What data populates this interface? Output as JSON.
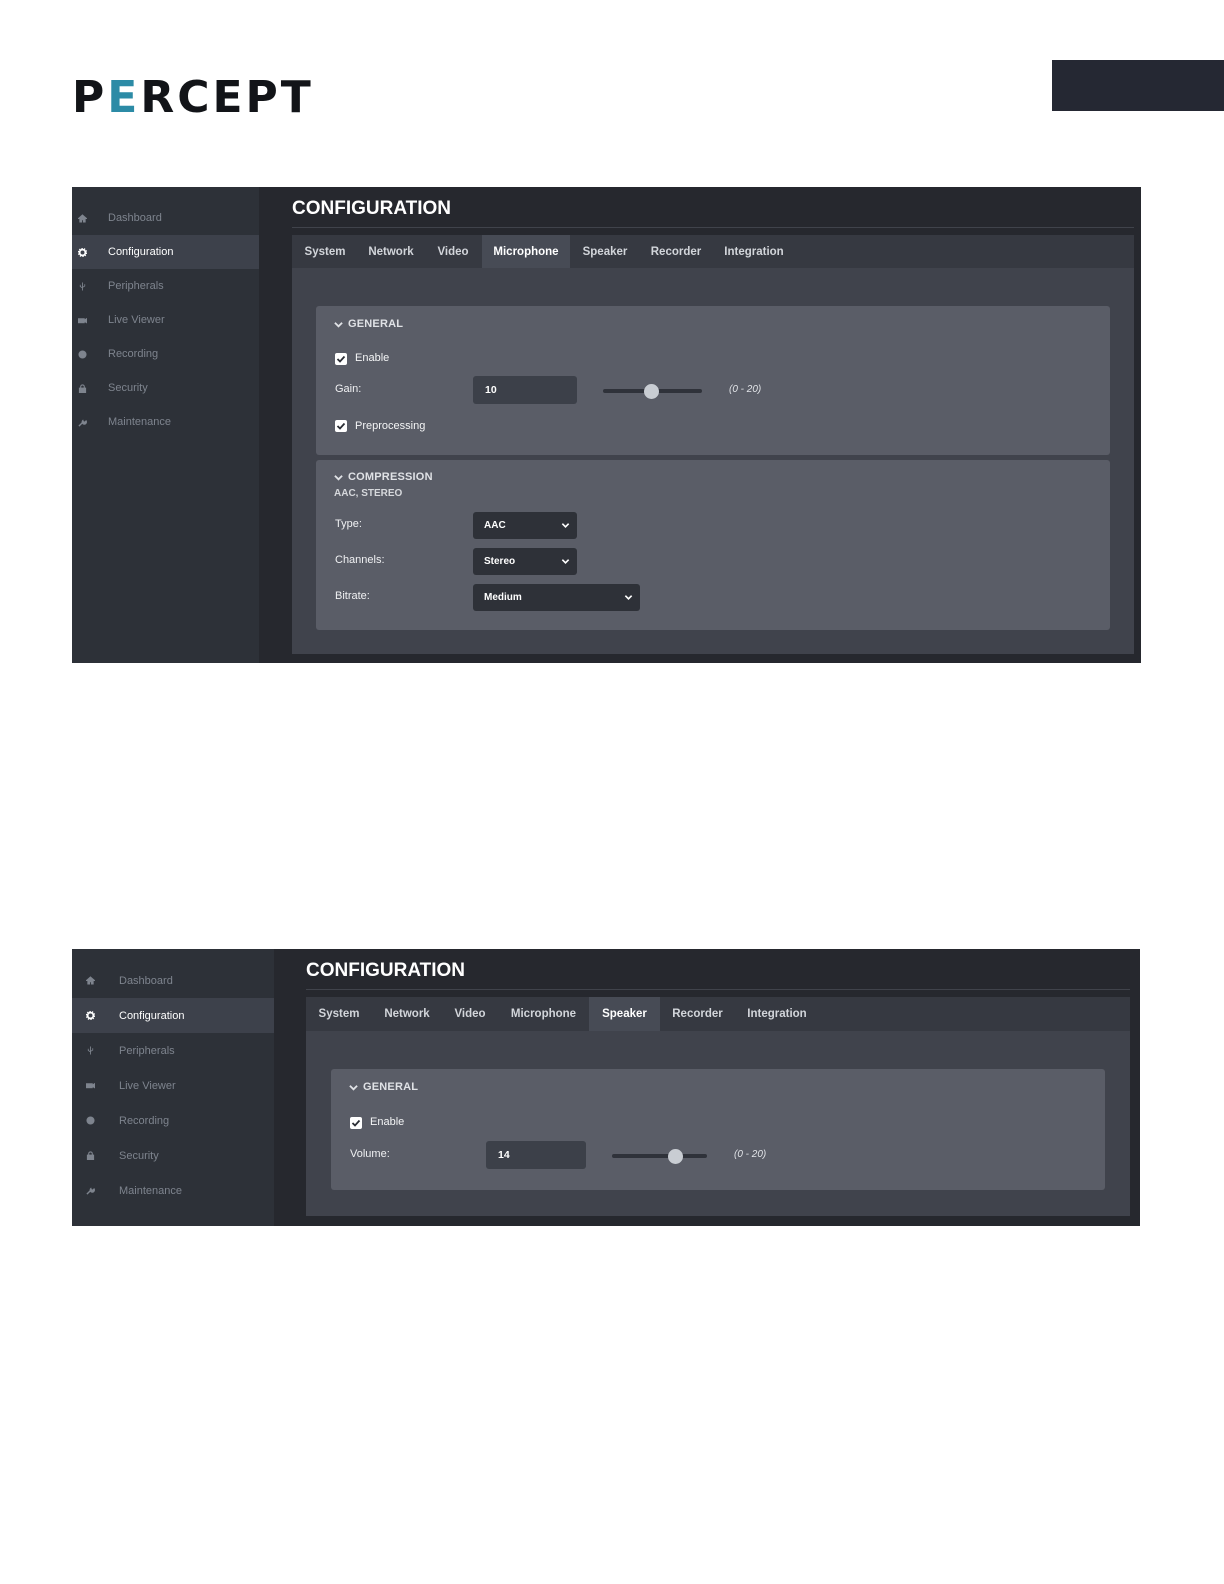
{
  "logo": {
    "text_a": "P",
    "text_accent": "E",
    "text_b": "RCEPT"
  },
  "nav_items": [
    {
      "label": "Dashboard",
      "icon": "home-icon"
    },
    {
      "label": "Configuration",
      "icon": "gear-icon"
    },
    {
      "label": "Peripherals",
      "icon": "usb-icon"
    },
    {
      "label": "Live Viewer",
      "icon": "camera-icon"
    },
    {
      "label": "Recording",
      "icon": "record-icon"
    },
    {
      "label": "Security",
      "icon": "lock-icon"
    },
    {
      "label": "Maintenance",
      "icon": "wrench-icon"
    }
  ],
  "tabs": [
    "System",
    "Network",
    "Video",
    "Microphone",
    "Speaker",
    "Recorder",
    "Integration"
  ],
  "microphone_screen": {
    "active_nav": "Configuration",
    "title": "CONFIGURATION",
    "active_tab": "Microphone",
    "general": {
      "heading": "GENERAL",
      "enable_label": "Enable",
      "enable_checked": true,
      "gain_label": "Gain:",
      "gain_value": "10",
      "gain_range": "(0 - 20)",
      "preprocessing_label": "Preprocessing",
      "preprocessing_checked": true
    },
    "compression": {
      "heading": "COMPRESSION",
      "summary": "AAC, STEREO",
      "type_label": "Type:",
      "type_value": "AAC",
      "channels_label": "Channels:",
      "channels_value": "Stereo",
      "bitrate_label": "Bitrate:",
      "bitrate_value": "Medium"
    }
  },
  "speaker_screen": {
    "active_nav": "Configuration",
    "title": "CONFIGURATION",
    "active_tab": "Speaker",
    "general": {
      "heading": "GENERAL",
      "enable_label": "Enable",
      "enable_checked": true,
      "volume_label": "Volume:",
      "volume_value": "14",
      "volume_range": "(0 - 20)"
    }
  },
  "colors": {
    "accent": "#2c8ba6",
    "background": "#26282e",
    "sidebar": "#2d3138",
    "panel": "#5a5d67"
  }
}
